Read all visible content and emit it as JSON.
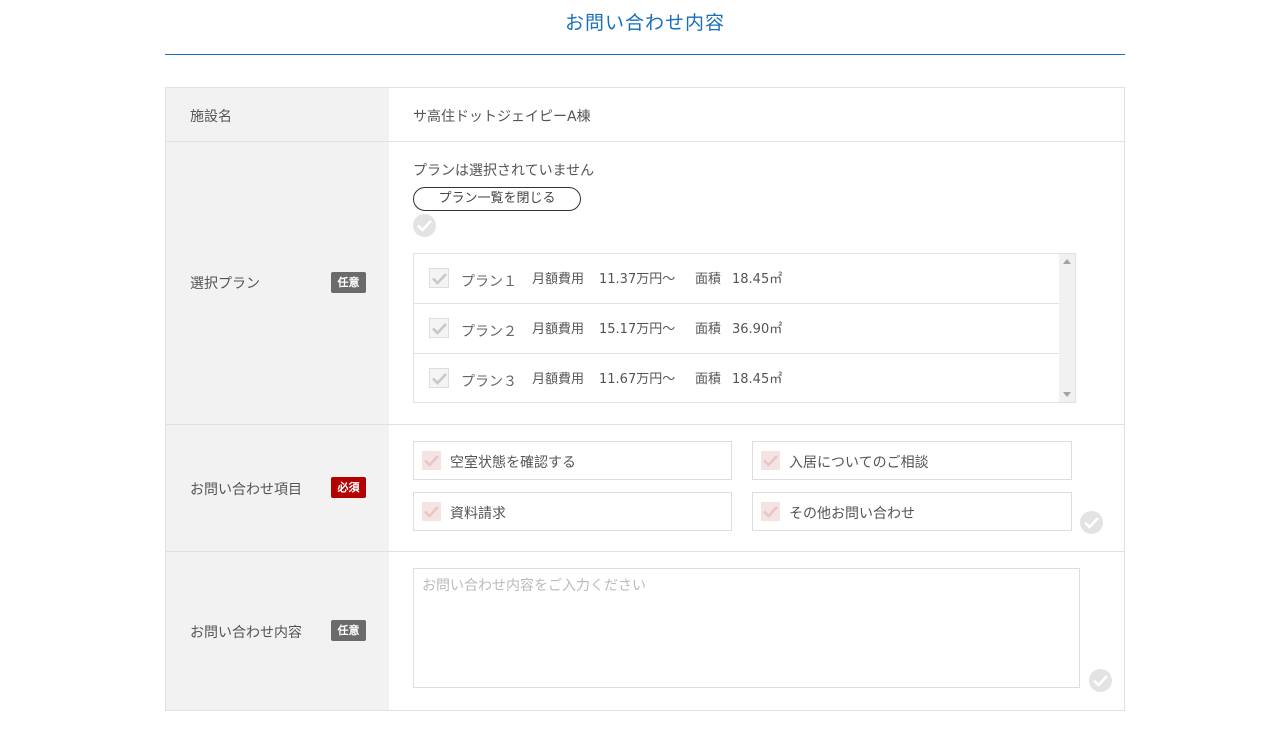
{
  "page_title": "お問い合わせ内容",
  "facility": {
    "label": "施設名",
    "value": "サ高住ドットジェイピーA棟"
  },
  "plan": {
    "label": "選択プラン",
    "badge": "任意",
    "status": "プランは選択されていません",
    "toggle_label": "プラン一覧を閉じる",
    "items": [
      {
        "name": "プラン１",
        "fee_label": "月額費用",
        "fee": "11.37万円〜",
        "area_label": "面積",
        "area": "18.45㎡"
      },
      {
        "name": "プラン２",
        "fee_label": "月額費用",
        "fee": "15.17万円〜",
        "area_label": "面積",
        "area": "36.90㎡"
      },
      {
        "name": "プラン３",
        "fee_label": "月額費用",
        "fee": "11.67万円〜",
        "area_label": "面積",
        "area": "18.45㎡"
      }
    ]
  },
  "inquiry_items": {
    "label": "お問い合わせ項目",
    "badge": "必須",
    "options": [
      "空室状態を確認する",
      "入居についてのご相談",
      "資料請求",
      "その他お問い合わせ"
    ]
  },
  "inquiry_content": {
    "label": "お問い合わせ内容",
    "badge": "任意",
    "placeholder": "お問い合わせ内容をご入力ください",
    "value": ""
  },
  "colors": {
    "accent": "#1a6fba",
    "required_badge": "#b30000",
    "optional_badge": "#6b6b6b",
    "label_bg": "#f2f2f2"
  }
}
